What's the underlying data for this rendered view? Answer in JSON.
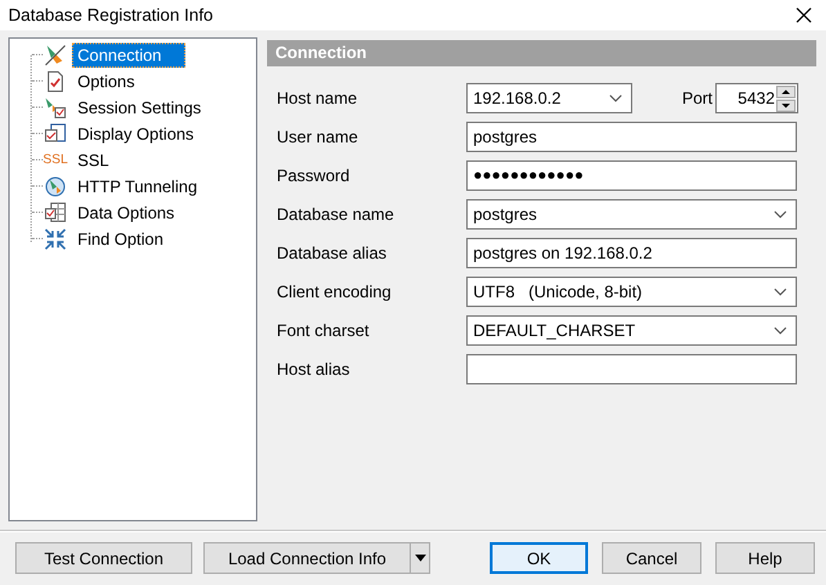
{
  "window": {
    "title": "Database Registration Info"
  },
  "tree": {
    "items": [
      {
        "label": "Connection",
        "kind": "plug",
        "selected": true
      },
      {
        "label": "Options",
        "kind": "options",
        "selected": false
      },
      {
        "label": "Session Settings",
        "kind": "session",
        "selected": false
      },
      {
        "label": "Display Options",
        "kind": "display",
        "selected": false
      },
      {
        "label": "SSL",
        "kind": "ssl",
        "icon_text": "SSL",
        "selected": false
      },
      {
        "label": "HTTP Tunneling",
        "kind": "http",
        "selected": false
      },
      {
        "label": "Data Options",
        "kind": "data",
        "selected": false
      },
      {
        "label": "Find Option",
        "kind": "find",
        "selected": false
      }
    ]
  },
  "panel": {
    "title": "Connection",
    "fields": [
      {
        "label": "Host name",
        "kind": "combo",
        "value": "192.168.0.2",
        "port": {
          "label": "Port",
          "value": "5432"
        }
      },
      {
        "label": "User name",
        "kind": "text",
        "value": "postgres"
      },
      {
        "label": "Password",
        "kind": "password",
        "value": "●●●●●●●●●●●●"
      },
      {
        "label": "Database name",
        "kind": "combo",
        "value": "postgres"
      },
      {
        "label": "Database alias",
        "kind": "text",
        "value": "postgres on 192.168.0.2"
      },
      {
        "label": "Client encoding",
        "kind": "combo",
        "value": "UTF8   (Unicode, 8-bit)"
      },
      {
        "label": "Font charset",
        "kind": "combo",
        "value": "DEFAULT_CHARSET"
      },
      {
        "label": "Host alias",
        "kind": "text"
      }
    ]
  },
  "buttons": [
    {
      "label": "Test Connection",
      "kind": "plain",
      "default": false
    },
    {
      "label": "Load Connection Info",
      "kind": "split",
      "default": false
    },
    {
      "label": "OK",
      "kind": "plain",
      "default": true
    },
    {
      "label": "Cancel",
      "kind": "plain",
      "default": false
    },
    {
      "label": "Help",
      "kind": "plain",
      "default": false
    }
  ]
}
